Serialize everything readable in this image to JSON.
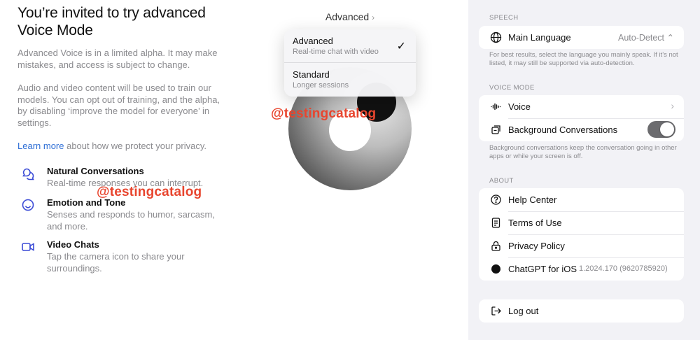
{
  "invite": {
    "title": "You’re invited to try advanced Voice Mode",
    "paragraph1": "Advanced Voice is in a limited alpha. It may make mistakes, and access is subject to change.",
    "paragraph2": "Audio and video content will be used to train our models. You can opt out of training, and the alpha, by disabling ‘improve the model for everyone’ in settings.",
    "learn_more_link": "Learn more",
    "learn_more_rest": " about how we protect your privacy.",
    "features": [
      {
        "icon": "chat-bubbles-icon",
        "name": "Natural Conversations",
        "desc": "Real-time responses you can interrupt."
      },
      {
        "icon": "smiley-face-icon",
        "name": "Emotion and Tone",
        "desc": "Senses and responds to humor, sarcasm, and more."
      },
      {
        "icon": "video-camera-icon",
        "name": "Video Chats",
        "desc": "Tap the camera icon to share your surroundings."
      }
    ]
  },
  "watermark": "@testingcatalog",
  "voice_picker": {
    "header": "Advanced",
    "options": [
      {
        "name": "Advanced",
        "sub": "Real-time chat with video",
        "selected": true
      },
      {
        "name": "Standard",
        "sub": "Longer sessions",
        "selected": false
      }
    ]
  },
  "settings": {
    "speech_label": "SPEECH",
    "main_language_label": "Main Language",
    "main_language_value": "Auto-Detect",
    "speech_note": "For best results, select the language you mainly speak. If it’s not listed, it may still be supported via auto-detection.",
    "voice_mode_label": "VOICE MODE",
    "voice_label": "Voice",
    "background_label": "Background Conversations",
    "background_enabled": true,
    "background_note": "Background conversations keep the conversation going in other apps or while your screen is off.",
    "about_label": "ABOUT",
    "help_center": "Help Center",
    "terms": "Terms of Use",
    "privacy": "Privacy Policy",
    "app_name": "ChatGPT for iOS",
    "app_version": "1.2024.170 (9620785920)",
    "logout": "Log out"
  },
  "colors": {
    "accent_icon": "#3b4bd6",
    "link": "#2f6fd6",
    "watermark": "#e8452e",
    "settings_bg": "#f2f2f6"
  }
}
